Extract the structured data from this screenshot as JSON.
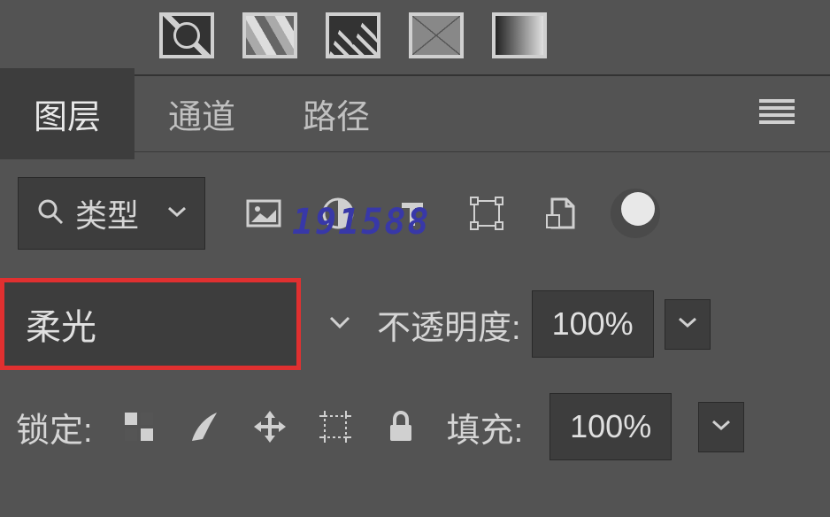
{
  "tabs": {
    "layers": "图层",
    "channels": "通道",
    "paths": "路径"
  },
  "filter": {
    "kind_label": "类型"
  },
  "blend": {
    "mode": "柔光",
    "opacity_label": "不透明度:",
    "opacity_value": "100%"
  },
  "lock": {
    "label": "锁定:",
    "fill_label": "填充:",
    "fill_value": "100%"
  },
  "watermark": "191588"
}
